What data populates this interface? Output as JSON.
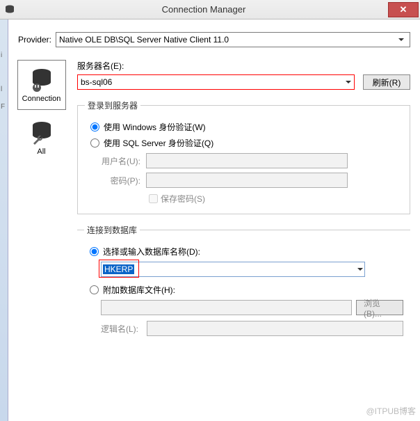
{
  "title": "Connection Manager",
  "provider": {
    "label": "Provider:",
    "value": "Native OLE DB\\SQL Server Native Client 11.0"
  },
  "tabs": {
    "connection": "Connection",
    "all": "All"
  },
  "server": {
    "label": "服务器名(E):",
    "value": "bs-sql06",
    "refresh": "刷新(R)"
  },
  "logon": {
    "legend": "登录到服务器",
    "windows": "使用 Windows 身份验证(W)",
    "sql": "使用 SQL Server 身份验证(Q)",
    "user_label": "用户名(U):",
    "pass_label": "密码(P):",
    "savepass": "保存密码(S)"
  },
  "db": {
    "legend": "连接到数据库",
    "select_label": "选择或输入数据库名称(D):",
    "selected": "HKERP",
    "attach_label": "附加数据库文件(H):",
    "browse": "浏览(B)...",
    "logical_label": "逻辑名(L):"
  },
  "leftband": {
    "a": "i",
    "b": "l",
    "c": "F"
  },
  "watermark": "@ITPUB博客"
}
